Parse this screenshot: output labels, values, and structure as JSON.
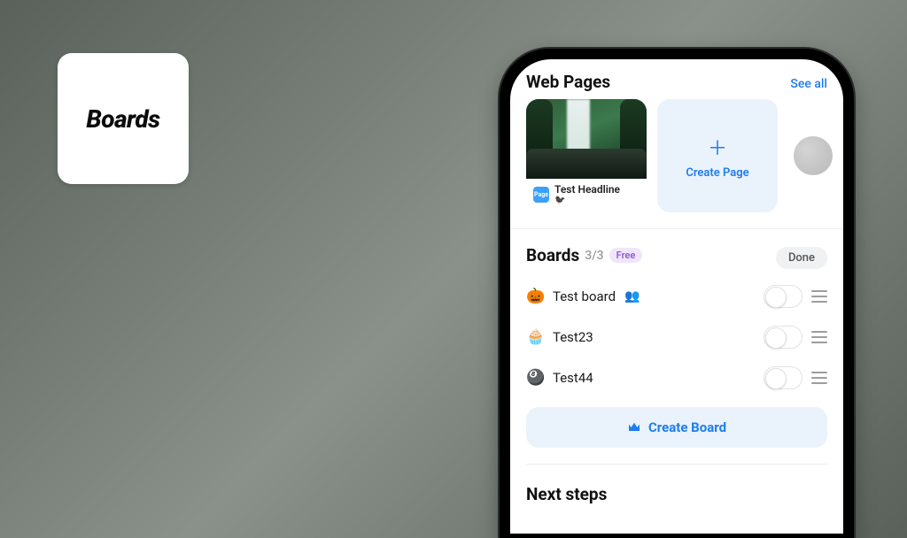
{
  "badge": {
    "label": "Boards"
  },
  "webpages": {
    "title": "Web Pages",
    "see_all": "See all",
    "page_card": {
      "headline": "Test Headline"
    },
    "create_label": "Create Page"
  },
  "boards": {
    "title": "Boards",
    "count": "3/3",
    "tier": "Free",
    "done": "Done",
    "items": [
      {
        "emoji": "🎃",
        "name": "Test board",
        "shared": true
      },
      {
        "emoji": "🧁",
        "name": "Test23",
        "shared": false
      },
      {
        "emoji": "🎱",
        "name": "Test44",
        "shared": false
      }
    ],
    "create_label": "Create Board"
  },
  "next_steps": {
    "title": "Next steps"
  }
}
